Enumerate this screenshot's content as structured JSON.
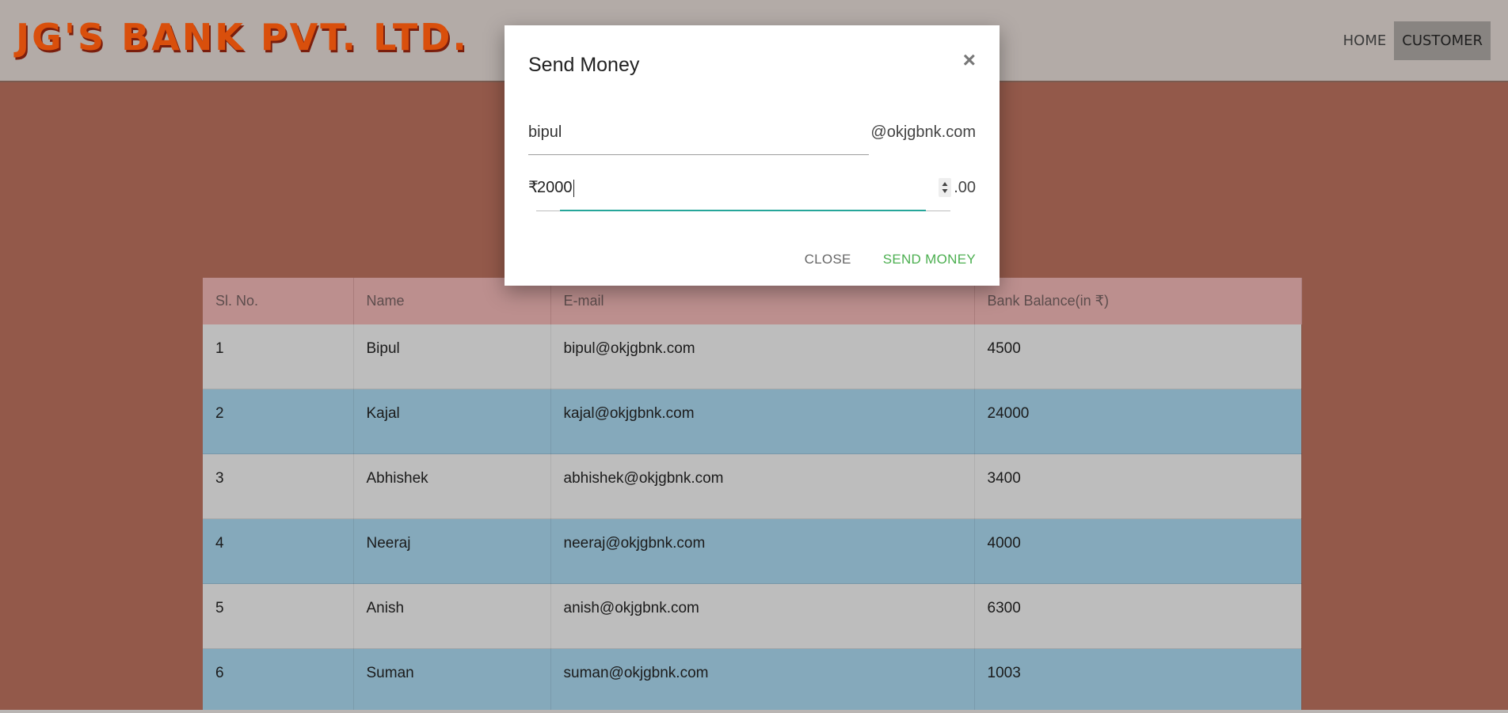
{
  "header": {
    "brand": "JG'S BANK PVT. LTD.",
    "nav": [
      {
        "label": "HOME"
      },
      {
        "label": "CUSTOMER",
        "active": true
      }
    ]
  },
  "table": {
    "columns": [
      "Sl. No.",
      "Name",
      "E-mail",
      "Bank Balance(in ₹)"
    ],
    "rows": [
      {
        "sl": "1",
        "name": "Bipul",
        "email": "bipul@okjgbnk.com",
        "balance": "4500"
      },
      {
        "sl": "2",
        "name": "Kajal",
        "email": "kajal@okjgbnk.com",
        "balance": "24000"
      },
      {
        "sl": "3",
        "name": "Abhishek",
        "email": "abhishek@okjgbnk.com",
        "balance": "3400"
      },
      {
        "sl": "4",
        "name": "Neeraj",
        "email": "neeraj@okjgbnk.com",
        "balance": "4000"
      },
      {
        "sl": "5",
        "name": "Anish",
        "email": "anish@okjgbnk.com",
        "balance": "6300"
      },
      {
        "sl": "6",
        "name": "Suman",
        "email": "suman@okjgbnk.com",
        "balance": "1003"
      }
    ]
  },
  "modal": {
    "title": "Send Money",
    "close_symbol": "×",
    "username_value": "bipul",
    "username_suffix": "@okjgbnk.com",
    "currency_symbol": "₹",
    "amount_value": "2000",
    "amount_suffix": ".00",
    "close_label": "CLOSE",
    "send_label": "SEND MONEY"
  },
  "colors": {
    "page_bg": "#93594a",
    "header_bg": "#b3aba7",
    "brand": "#d94f0c",
    "table_header": "#bc8f8e",
    "row_gray": "#bdbdbd",
    "row_blue": "#85a9bb",
    "accent_teal": "#26a69a",
    "send_green": "#4caf50"
  }
}
